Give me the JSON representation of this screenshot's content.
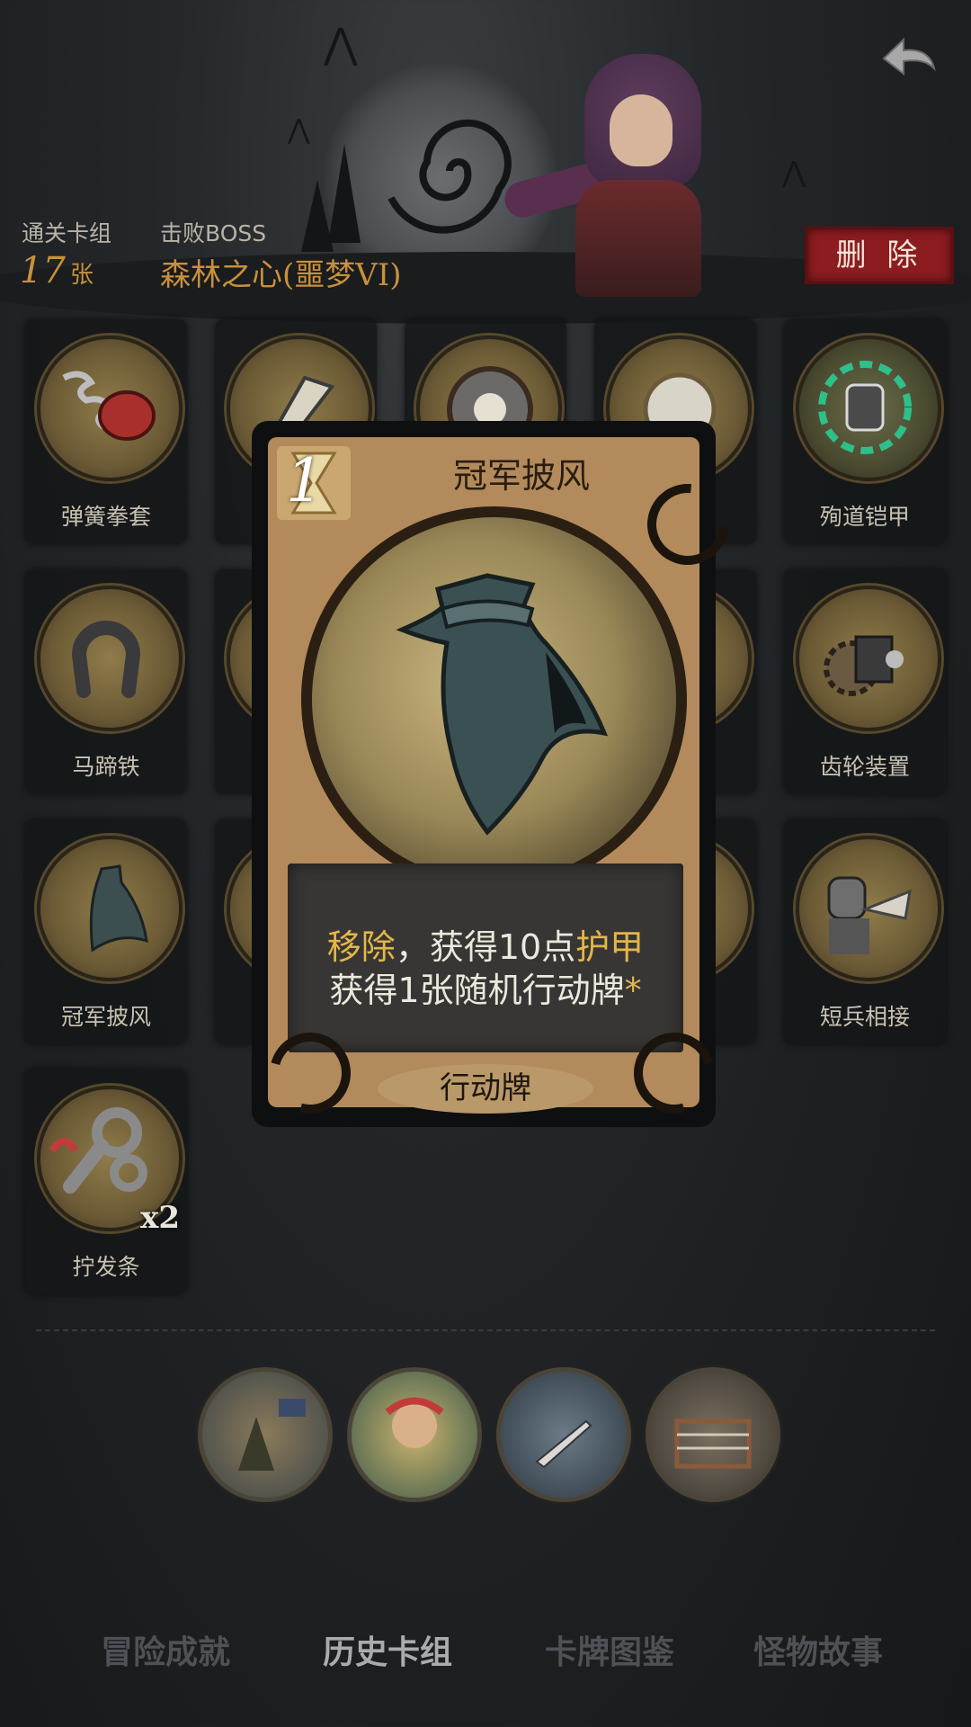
{
  "header": {
    "deck_label": "通关卡组",
    "deck_count": "17",
    "deck_unit": "张",
    "boss_label": "击败BOSS",
    "boss_name": "森林之心(噩梦VI)",
    "delete_label": "删 除"
  },
  "grid": {
    "cards": [
      {
        "name": "弹簧拳套",
        "icon": "spring-glove-icon"
      },
      {
        "name": "",
        "icon": "blade-icon"
      },
      {
        "name": "",
        "icon": "skull-shield-icon"
      },
      {
        "name": "",
        "icon": "pocket-watch-icon"
      },
      {
        "name": "殉道铠甲",
        "icon": "martyr-armor-icon"
      },
      {
        "name": "马蹄铁",
        "icon": "horseshoe-icon"
      },
      {
        "name": "齿轮装置",
        "icon": "gear-device-icon"
      },
      {
        "name": "冠军披风",
        "icon": "cloak-icon"
      },
      {
        "name": "短兵相接",
        "icon": "knight-icon"
      },
      {
        "name": "拧发条",
        "icon": "wind-up-key-icon",
        "badge": "x2"
      }
    ]
  },
  "popup": {
    "cost": "1",
    "title": "冠军披风",
    "desc_line1_a": "移除",
    "desc_line1_b": "，获得10点",
    "desc_line1_c": "护甲",
    "desc_line2": "获得1张随机行动牌",
    "desc_star": "*",
    "type": "行动牌",
    "icon": "cloak-icon"
  },
  "relics": [
    "herald-relic-icon",
    "dryad-relic-icon",
    "dagger-relic-icon",
    "boxing-ring-relic-icon"
  ],
  "tabs": [
    {
      "label": "冒险成就",
      "active": false
    },
    {
      "label": "历史卡组",
      "active": true
    },
    {
      "label": "卡牌图鉴",
      "active": false
    },
    {
      "label": "怪物故事",
      "active": false
    }
  ],
  "colors": {
    "accent": "#c8913c",
    "delete": "#8c1c1f",
    "highlight": "#e3b64a"
  }
}
